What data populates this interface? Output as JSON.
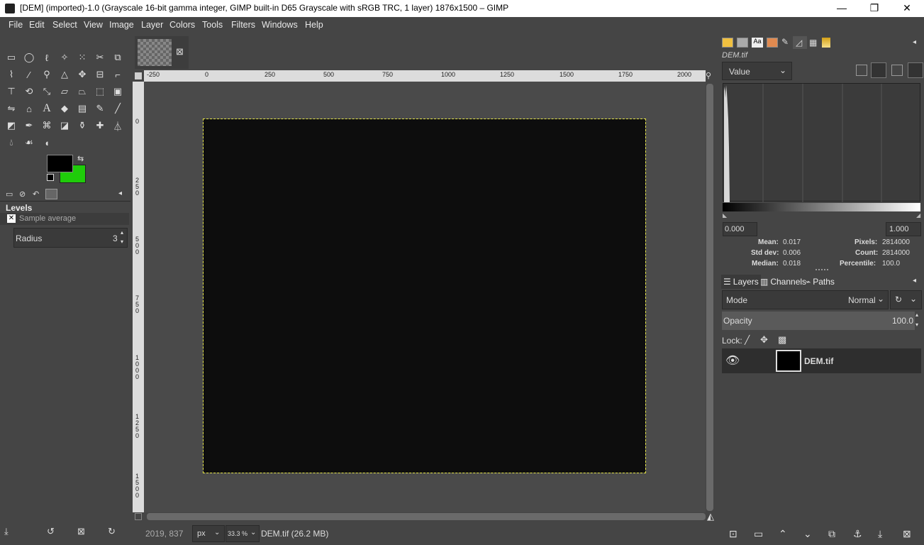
{
  "window": {
    "title": "[DEM] (imported)-1.0 (Grayscale 16-bit gamma integer, GIMP built-in D65 Grayscale with sRGB TRC, 1 layer) 1876x1500 – GIMP",
    "minimize_icon": "minimize-icon",
    "maximize_icon": "restore-icon",
    "close_icon": "close-icon"
  },
  "menubar": [
    "File",
    "Edit",
    "Select",
    "View",
    "Image",
    "Layer",
    "Colors",
    "Tools",
    "Filters",
    "Windows",
    "Help"
  ],
  "image_tab": {
    "close_glyph": "⊠"
  },
  "toolbox": {
    "tools": [
      "rect-select-icon",
      "ellipse-select-icon",
      "free-select-icon",
      "fuzzy-select-icon",
      "select-by-color-icon",
      "scissors-select-icon",
      "foreground-select-icon",
      "paths-icon",
      "color-picker-icon",
      "zoom-icon",
      "measure-icon",
      "move-icon",
      "align-icon",
      "crop-icon",
      "unified-transform-icon",
      "rotate-icon",
      "scale-icon",
      "shear-icon",
      "perspective-icon",
      "3d-transform-icon",
      "warp-transform-icon",
      "flip-icon",
      "cage-transform-icon",
      "text-icon",
      "bucket-fill-icon",
      "gradient-icon",
      "pencil-icon",
      "paintbrush-icon",
      "eraser-icon",
      "airbrush-icon",
      "ink-icon",
      "mypaint-brush-icon",
      "clone-icon",
      "heal-icon",
      "perspective-clone-icon",
      "blur-icon",
      "smudge-icon",
      "dodge-burn-icon"
    ],
    "fg_color": "#000000",
    "bg_color": "#1fcc0a"
  },
  "tool_options": {
    "title": "Levels",
    "sample_average_label": "Sample average",
    "radius_label": "Radius",
    "radius_value": "3"
  },
  "rulers": {
    "h_ticks": [
      "-250",
      "0",
      "250",
      "500",
      "750",
      "1000",
      "1250",
      "1500",
      "1750",
      "2000"
    ],
    "v_ticks": [
      "0",
      "2\n5\n0",
      "5\n0\n0",
      "7\n5\n0",
      "1\n0\n0\n0",
      "1\n2\n5\n0",
      "1\n5\n0\n0"
    ]
  },
  "status": {
    "coords": "2019, 837",
    "unit": "px",
    "zoom": "33.3 %",
    "file_info": "DEM.tif (26.2 MB)"
  },
  "histogram": {
    "image_name": "DEM.tif",
    "channel": "Value",
    "range_low": "0.000",
    "range_high": "1.000",
    "mean_label": "Mean:",
    "mean": "0.017",
    "std_label": "Std dev:",
    "std": "0.006",
    "median_label": "Median:",
    "median": "0.018",
    "pixels_label": "Pixels:",
    "pixels": "2814000",
    "count_label": "Count:",
    "count": "2814000",
    "percentile_label": "Percentile:",
    "percentile": "100.0"
  },
  "layers_panel": {
    "tabs": [
      "Layers",
      "Channels",
      "Paths"
    ],
    "mode_label": "Mode",
    "mode_value": "Normal",
    "opacity_label": "Opacity",
    "opacity_value": "100.0",
    "lock_label": "Lock:",
    "layer_name": "DEM.tif"
  }
}
